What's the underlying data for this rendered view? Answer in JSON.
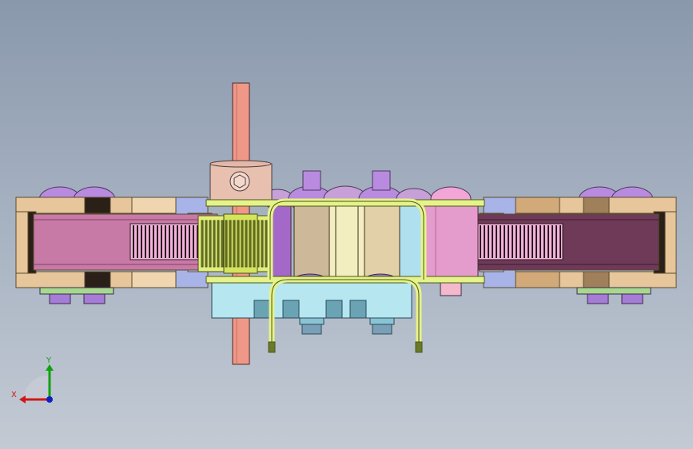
{
  "viewport": {
    "background_top": "#8a98ac",
    "background_bottom": "#c3cad4"
  },
  "triad": {
    "x_label": "X",
    "y_label": "Y",
    "x_color": "#d01818",
    "y_color": "#10a010",
    "z_color": "#1020c0"
  },
  "colors": {
    "link_plate": "#e6c69a",
    "link_plate_edge": "#5a4a30",
    "inner_plate": "#c87aa6",
    "dark_inner_plate": "#6e3a58",
    "pin_head": "#b98be0",
    "pin_foot": "#a67cd6",
    "shaft": "#f09888",
    "hub": "#e8c0b0",
    "gear_green": "#e2f07a",
    "bracket_frame": "#e6f28a",
    "block_tan": "#cdb89a",
    "block_cream": "#f2eec0",
    "base_cyan": "#b6e6f0",
    "washer_green": "#a8d890",
    "spacer_blue": "#a8b4e8"
  },
  "icons": {
    "socket": "hex-socket-icon",
    "triad": "axis-triad-icon"
  }
}
